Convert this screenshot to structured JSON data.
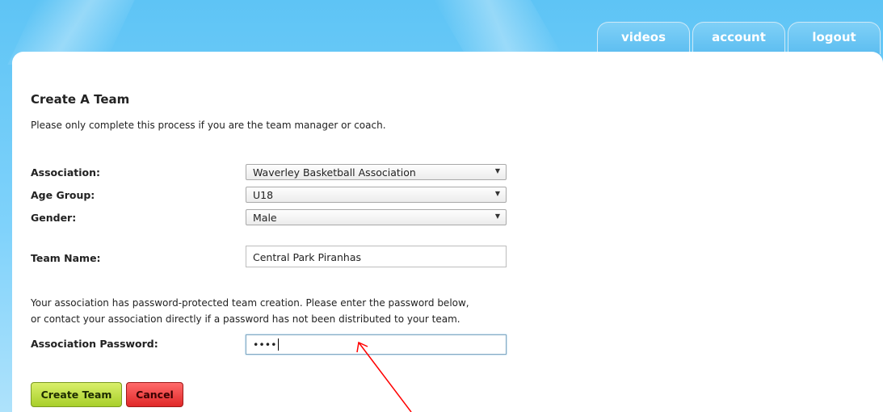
{
  "nav": {
    "tabs": [
      {
        "label": "videos"
      },
      {
        "label": "account"
      },
      {
        "label": "logout"
      }
    ]
  },
  "form": {
    "title": "Create A Team",
    "intro": "Please only complete this process if you are the team manager or coach.",
    "association": {
      "label": "Association:",
      "value": "Waverley Basketball Association"
    },
    "age_group": {
      "label": "Age Group:",
      "value": "U18"
    },
    "gender": {
      "label": "Gender:",
      "value": "Male"
    },
    "team_name": {
      "label": "Team Name:",
      "value": "Central Park Piranhas"
    },
    "password_note_line1": "Your association has password-protected team creation. Please enter the password below,",
    "password_note_line2": "or contact your association directly if a password has not been distributed to your team.",
    "password": {
      "label": "Association Password:",
      "masked_value": "••••"
    },
    "create_button": "Create Team",
    "cancel_button": "Cancel"
  },
  "colors": {
    "sky": "#6fcdf8",
    "create_button": "#b5d83a",
    "cancel_button": "#f04545",
    "annotation_arrow": "#ff0000"
  },
  "icons": {
    "dropdown": "chevron-down-icon"
  }
}
